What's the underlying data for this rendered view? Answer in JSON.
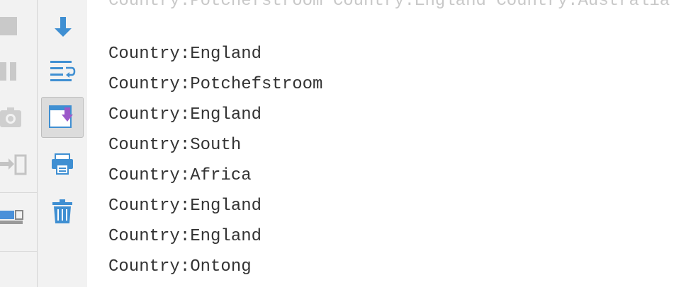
{
  "console": {
    "cut_line": "Country:Potchefstroom Country:England Country:Australia",
    "lines": [
      "Country:England",
      "Country:Potchefstroom",
      "Country:England",
      "Country:South",
      "Country:Africa",
      "Country:England",
      "Country:England",
      "Country:Ontong"
    ]
  },
  "icons": {
    "left": [
      "stop-icon",
      "pause-icon",
      "camera-icon",
      "login-icon",
      "layout-icon"
    ],
    "right": [
      "scroll-down-icon",
      "soft-wrap-icon",
      "scroll-to-end-icon",
      "print-icon",
      "trash-icon"
    ]
  },
  "colors": {
    "toolbar_bg": "#f2f2f2",
    "accent_blue": "#3f8fd2",
    "accent_purple": "#9b59c9",
    "text": "#333333"
  }
}
